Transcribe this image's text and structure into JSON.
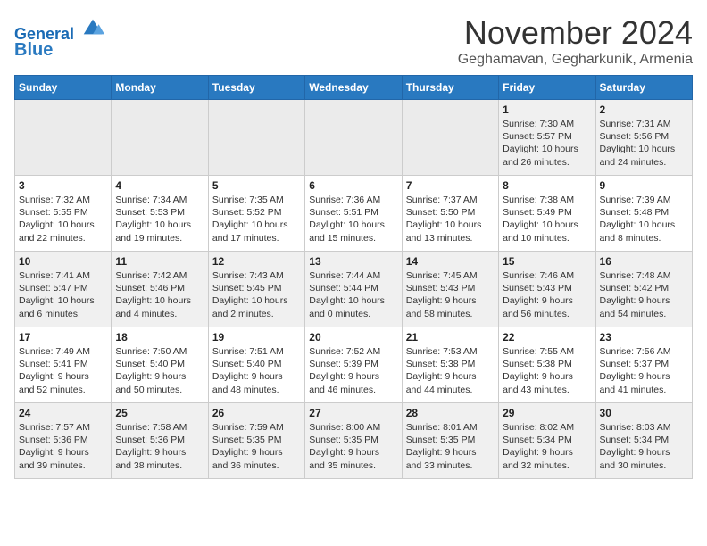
{
  "header": {
    "logo_line1": "General",
    "logo_line2": "Blue",
    "month": "November 2024",
    "location": "Geghamavan, Gegharkunik, Armenia"
  },
  "weekdays": [
    "Sunday",
    "Monday",
    "Tuesday",
    "Wednesday",
    "Thursday",
    "Friday",
    "Saturday"
  ],
  "weeks": [
    [
      {
        "day": "",
        "info": ""
      },
      {
        "day": "",
        "info": ""
      },
      {
        "day": "",
        "info": ""
      },
      {
        "day": "",
        "info": ""
      },
      {
        "day": "",
        "info": ""
      },
      {
        "day": "1",
        "info": "Sunrise: 7:30 AM\nSunset: 5:57 PM\nDaylight: 10 hours\nand 26 minutes."
      },
      {
        "day": "2",
        "info": "Sunrise: 7:31 AM\nSunset: 5:56 PM\nDaylight: 10 hours\nand 24 minutes."
      }
    ],
    [
      {
        "day": "3",
        "info": "Sunrise: 7:32 AM\nSunset: 5:55 PM\nDaylight: 10 hours\nand 22 minutes."
      },
      {
        "day": "4",
        "info": "Sunrise: 7:34 AM\nSunset: 5:53 PM\nDaylight: 10 hours\nand 19 minutes."
      },
      {
        "day": "5",
        "info": "Sunrise: 7:35 AM\nSunset: 5:52 PM\nDaylight: 10 hours\nand 17 minutes."
      },
      {
        "day": "6",
        "info": "Sunrise: 7:36 AM\nSunset: 5:51 PM\nDaylight: 10 hours\nand 15 minutes."
      },
      {
        "day": "7",
        "info": "Sunrise: 7:37 AM\nSunset: 5:50 PM\nDaylight: 10 hours\nand 13 minutes."
      },
      {
        "day": "8",
        "info": "Sunrise: 7:38 AM\nSunset: 5:49 PM\nDaylight: 10 hours\nand 10 minutes."
      },
      {
        "day": "9",
        "info": "Sunrise: 7:39 AM\nSunset: 5:48 PM\nDaylight: 10 hours\nand 8 minutes."
      }
    ],
    [
      {
        "day": "10",
        "info": "Sunrise: 7:41 AM\nSunset: 5:47 PM\nDaylight: 10 hours\nand 6 minutes."
      },
      {
        "day": "11",
        "info": "Sunrise: 7:42 AM\nSunset: 5:46 PM\nDaylight: 10 hours\nand 4 minutes."
      },
      {
        "day": "12",
        "info": "Sunrise: 7:43 AM\nSunset: 5:45 PM\nDaylight: 10 hours\nand 2 minutes."
      },
      {
        "day": "13",
        "info": "Sunrise: 7:44 AM\nSunset: 5:44 PM\nDaylight: 10 hours\nand 0 minutes."
      },
      {
        "day": "14",
        "info": "Sunrise: 7:45 AM\nSunset: 5:43 PM\nDaylight: 9 hours\nand 58 minutes."
      },
      {
        "day": "15",
        "info": "Sunrise: 7:46 AM\nSunset: 5:43 PM\nDaylight: 9 hours\nand 56 minutes."
      },
      {
        "day": "16",
        "info": "Sunrise: 7:48 AM\nSunset: 5:42 PM\nDaylight: 9 hours\nand 54 minutes."
      }
    ],
    [
      {
        "day": "17",
        "info": "Sunrise: 7:49 AM\nSunset: 5:41 PM\nDaylight: 9 hours\nand 52 minutes."
      },
      {
        "day": "18",
        "info": "Sunrise: 7:50 AM\nSunset: 5:40 PM\nDaylight: 9 hours\nand 50 minutes."
      },
      {
        "day": "19",
        "info": "Sunrise: 7:51 AM\nSunset: 5:40 PM\nDaylight: 9 hours\nand 48 minutes."
      },
      {
        "day": "20",
        "info": "Sunrise: 7:52 AM\nSunset: 5:39 PM\nDaylight: 9 hours\nand 46 minutes."
      },
      {
        "day": "21",
        "info": "Sunrise: 7:53 AM\nSunset: 5:38 PM\nDaylight: 9 hours\nand 44 minutes."
      },
      {
        "day": "22",
        "info": "Sunrise: 7:55 AM\nSunset: 5:38 PM\nDaylight: 9 hours\nand 43 minutes."
      },
      {
        "day": "23",
        "info": "Sunrise: 7:56 AM\nSunset: 5:37 PM\nDaylight: 9 hours\nand 41 minutes."
      }
    ],
    [
      {
        "day": "24",
        "info": "Sunrise: 7:57 AM\nSunset: 5:36 PM\nDaylight: 9 hours\nand 39 minutes."
      },
      {
        "day": "25",
        "info": "Sunrise: 7:58 AM\nSunset: 5:36 PM\nDaylight: 9 hours\nand 38 minutes."
      },
      {
        "day": "26",
        "info": "Sunrise: 7:59 AM\nSunset: 5:35 PM\nDaylight: 9 hours\nand 36 minutes."
      },
      {
        "day": "27",
        "info": "Sunrise: 8:00 AM\nSunset: 5:35 PM\nDaylight: 9 hours\nand 35 minutes."
      },
      {
        "day": "28",
        "info": "Sunrise: 8:01 AM\nSunset: 5:35 PM\nDaylight: 9 hours\nand 33 minutes."
      },
      {
        "day": "29",
        "info": "Sunrise: 8:02 AM\nSunset: 5:34 PM\nDaylight: 9 hours\nand 32 minutes."
      },
      {
        "day": "30",
        "info": "Sunrise: 8:03 AM\nSunset: 5:34 PM\nDaylight: 9 hours\nand 30 minutes."
      }
    ]
  ]
}
